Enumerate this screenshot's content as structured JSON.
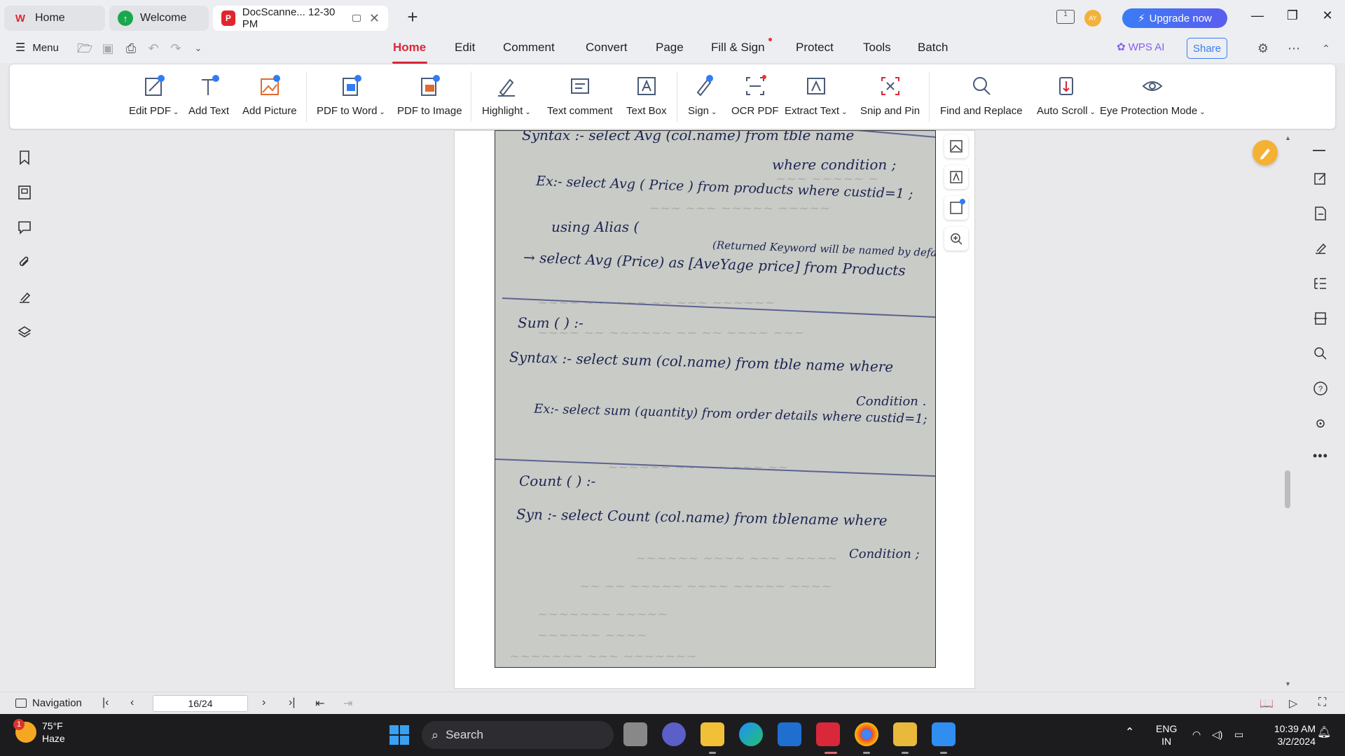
{
  "tabs": [
    {
      "label": "Home"
    },
    {
      "label": "Welcome"
    },
    {
      "label": "DocScanne... 12-30 PM"
    }
  ],
  "titlebar": {
    "upgrade_label": "Upgrade now",
    "avatar_initials": "AY",
    "page_badge": "1"
  },
  "menubar": {
    "menu_label": "Menu",
    "tabs": [
      "Home",
      "Edit",
      "Comment",
      "Convert",
      "Page",
      "Fill & Sign",
      "Protect",
      "Tools",
      "Batch"
    ],
    "wps_ai": "WPS AI",
    "share": "Share"
  },
  "ribbon": {
    "items": [
      {
        "label": "Edit PDF",
        "icon": "edit-pdf-icon"
      },
      {
        "label": "Add Text",
        "icon": "add-text-icon"
      },
      {
        "label": "Add Picture",
        "icon": "add-picture-icon"
      },
      {
        "label": "PDF to Word",
        "icon": "pdf-to-word-icon"
      },
      {
        "label": "PDF to Image",
        "icon": "pdf-to-image-icon"
      },
      {
        "label": "Highlight",
        "icon": "highlight-icon"
      },
      {
        "label": "Text comment",
        "icon": "text-comment-icon"
      },
      {
        "label": "Text Box",
        "icon": "text-box-icon"
      },
      {
        "label": "Sign",
        "icon": "sign-icon"
      },
      {
        "label": "OCR PDF",
        "icon": "ocr-icon"
      },
      {
        "label": "Extract Text",
        "icon": "extract-text-icon"
      },
      {
        "label": "Snip and Pin",
        "icon": "snip-icon"
      },
      {
        "label": "Find and Replace",
        "icon": "search-icon"
      },
      {
        "label": "Auto Scroll",
        "icon": "auto-scroll-icon"
      },
      {
        "label": "Eye Protection Mode",
        "icon": "eye-icon"
      }
    ]
  },
  "document": {
    "handwriting": {
      "l01": "Syntax :- select Avg (col.name) from tble name",
      "l02": "where condition ;",
      "l03": "Ex:- select Avg ( Price ) from products where custid=1 ;",
      "l04": "using Alias (",
      "l05": "(Returned Keyword will be named by default)",
      "l06": "→ select Avg (Price) as [AveYage price] from Products",
      "l07": "Sum ( ) :-",
      "l08": "Syntax :- select sum (col.name) from tble name where",
      "l09": "Condition .",
      "l10": "Ex:- select sum (quantity) from order details where custid=1;",
      "l11": "Count ( ) :-",
      "l12": "Syn :- select Count (col.name) from tblename where",
      "l13": "Condition ;"
    }
  },
  "statusbar": {
    "navigation": "Navigation",
    "page": "16/24"
  },
  "taskbar": {
    "temp": "75°F",
    "condition": "Haze",
    "weather_badge": "1",
    "search": "Search",
    "lang1": "ENG",
    "lang2": "IN",
    "time": "10:39 AM",
    "date": "3/2/2024"
  }
}
